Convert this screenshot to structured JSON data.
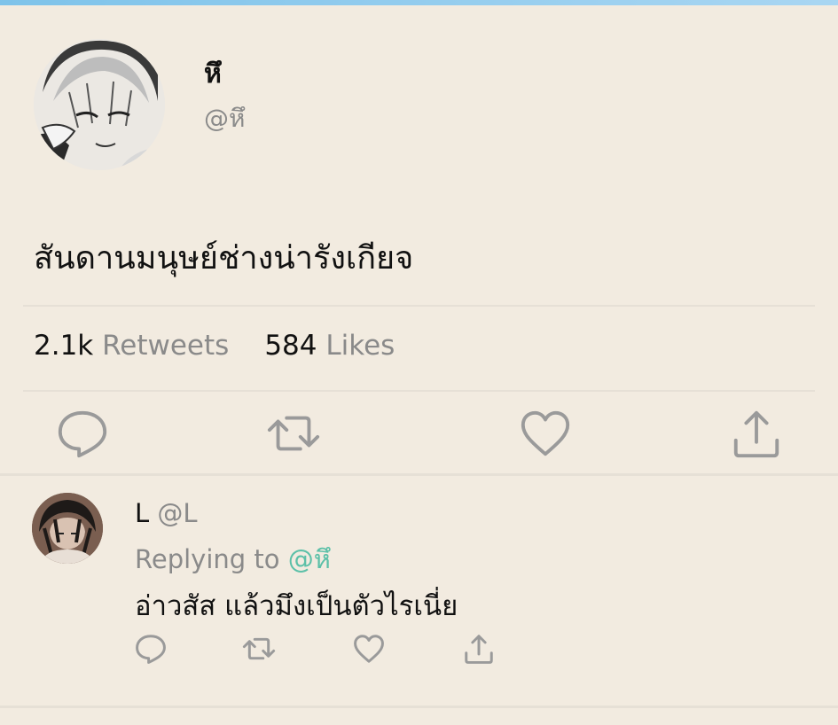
{
  "tweet": {
    "author_name": "หึ",
    "author_handle": "@หึ",
    "text": "สันดานมนุษย์ช่างน่ารังเกียจ",
    "retweets_count": "2.1k",
    "retweets_label": "Retweets",
    "likes_count": "584",
    "likes_label": "Likes"
  },
  "reply": {
    "author_name": "L",
    "author_handle": "@L",
    "replying_prefix": "Replying to",
    "replying_handle": "@หึ",
    "text": "อ่าวสัส แล้วมึงเป็นตัวไรเนี่ย"
  },
  "icons": [
    "reply-icon",
    "retweet-icon",
    "like-icon",
    "share-icon"
  ],
  "colors": {
    "background": "#f2ebe0",
    "icon_gray": "#9a9a9a",
    "mention": "#5cc0a8",
    "top_accent": "#7ec3ea"
  }
}
